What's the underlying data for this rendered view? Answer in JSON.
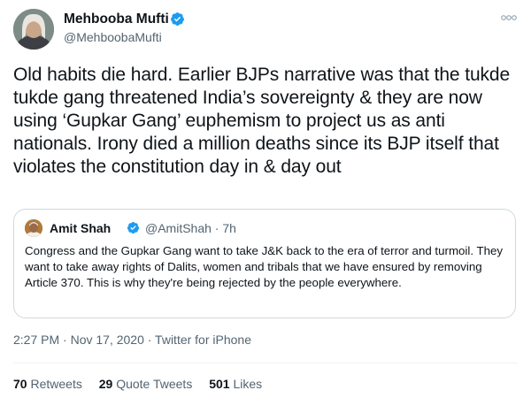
{
  "tweet": {
    "author": {
      "name": "Mehbooba Mufti",
      "handle": "@MehboobaMufti",
      "verified": true
    },
    "text": "Old habits die hard. Earlier BJPs narrative was that the tukde tukde gang threatened India’s sovereignty & they are now using ‘Gupkar Gang’ euphemism to project us as anti nationals. Irony died a million deaths since its BJP itself that violates the constitution day in & day out",
    "quoted": {
      "name": "Amit Shah",
      "handle": "@AmitShah · 7h",
      "verified": true,
      "text": "Congress and the Gupkar Gang want to take J&K back to the era of terror and turmoil. They want to take away rights of Dalits, women and tribals that we have ensured by removing Article 370. This is why they're being rejected by the people everywhere."
    },
    "meta": "2:27 PM · Nov 17, 2020 · Twitter for iPhone",
    "stats": {
      "retweets_count": "70",
      "retweets_label": "Retweets",
      "quote_tweets_count": "29",
      "quote_tweets_label": "Quote Tweets",
      "likes_count": "501",
      "likes_label": "Likes"
    }
  },
  "icons": {
    "verified": "verified-badge-icon",
    "more": "more-options-icon"
  },
  "colors": {
    "verified_blue": "#1d9bf0",
    "secondary_text": "#536471",
    "border": "#cfd9de"
  }
}
